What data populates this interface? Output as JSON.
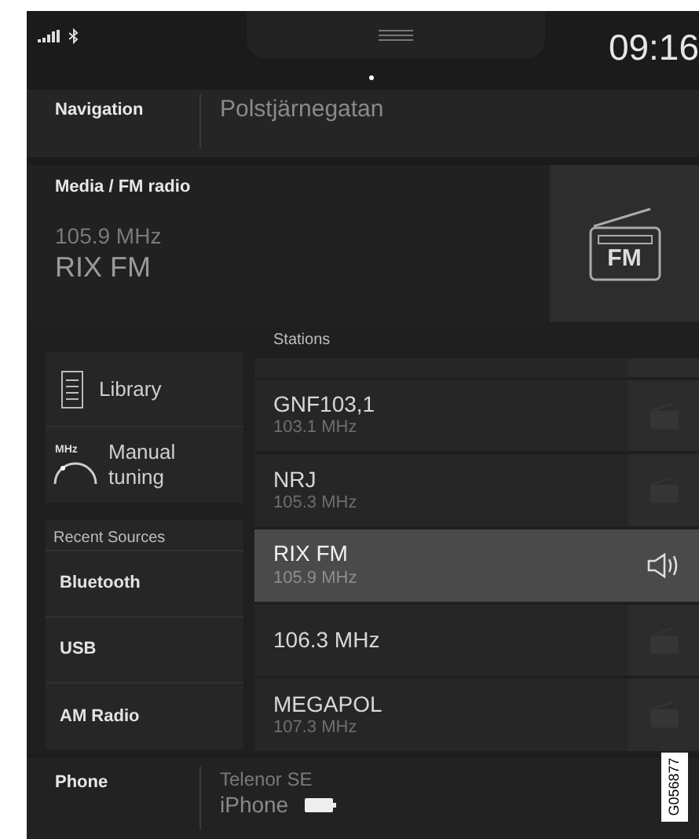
{
  "status_bar": {
    "time": "09:16"
  },
  "navigation": {
    "label": "Navigation",
    "destination": "Polstjärnegatan"
  },
  "media": {
    "label": "Media / FM radio",
    "frequency": "105.9 MHz",
    "station": "RIX FM",
    "badge": "FM"
  },
  "library": {
    "label": "Library"
  },
  "manual_tuning": {
    "label": "Manual tuning",
    "icon_text": "MHz"
  },
  "recent_sources": {
    "header": "Recent Sources",
    "items": [
      "Bluetooth",
      "USB",
      "AM Radio"
    ]
  },
  "stations": {
    "header": "Stations",
    "items": [
      {
        "name": "GNF103,1",
        "frequency": "103.1 MHz",
        "selected": false
      },
      {
        "name": "NRJ",
        "frequency": "105.3 MHz",
        "selected": false
      },
      {
        "name": "RIX FM",
        "frequency": "105.9 MHz",
        "selected": true
      },
      {
        "name": "106.3 MHz",
        "selected": false
      },
      {
        "name": "MEGAPOL",
        "frequency": "107.3 MHz",
        "selected": false
      }
    ]
  },
  "phone": {
    "label": "Phone",
    "carrier": "Telenor SE",
    "device": "iPhone"
  },
  "figure_code": "G056877"
}
